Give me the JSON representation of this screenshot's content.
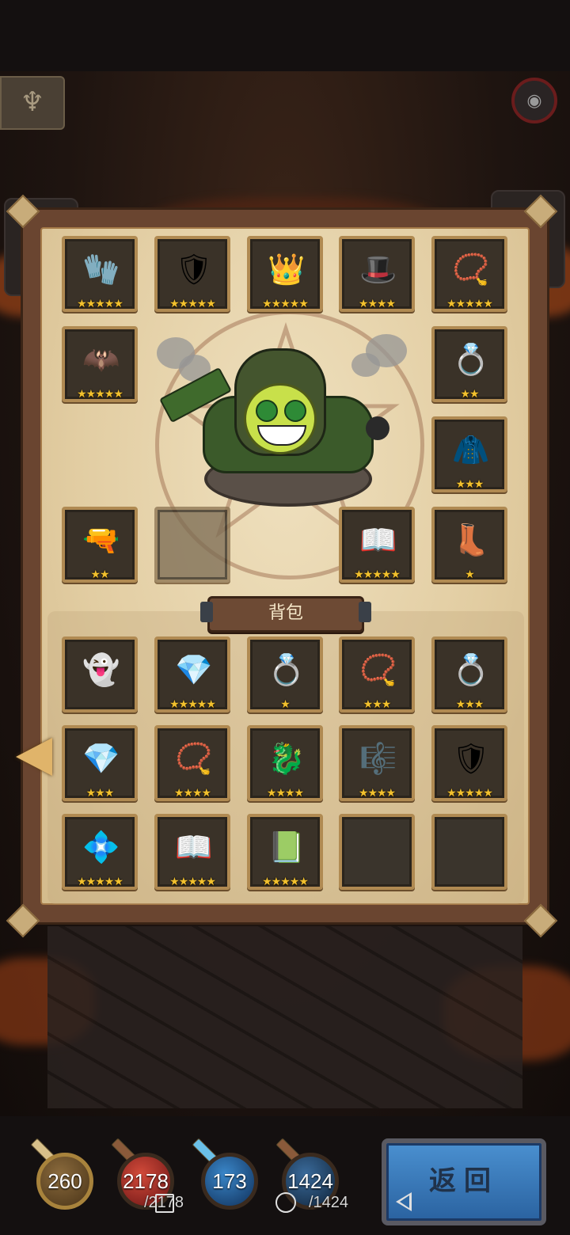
{
  "colors": {
    "star": "#f2c12e",
    "panel_bg": "#e2cda2",
    "slot_border": "#b08a52",
    "return_button": "#3a7cc0"
  },
  "equipment": [
    {
      "name": "glove",
      "icon": "purple-glove-icon",
      "glyph": "🧤",
      "stars": 5
    },
    {
      "name": "chest-armor",
      "icon": "purple-armor-icon",
      "glyph": "🛡",
      "stars": 5
    },
    {
      "name": "helmet",
      "icon": "flaming-crown-icon",
      "glyph": "👑",
      "stars": 5
    },
    {
      "name": "mask",
      "icon": "dark-hat-icon",
      "glyph": "🎩",
      "stars": 4
    },
    {
      "name": "amulet",
      "icon": "star-necklace-icon",
      "glyph": "📿",
      "stars": 5
    },
    {
      "name": "belt",
      "icon": "purple-belt-icon",
      "glyph": "🦇",
      "stars": 5
    },
    {
      "name": "ring",
      "icon": "silver-ring-icon",
      "glyph": "💍",
      "stars": 2
    },
    {
      "name": "cloak",
      "icon": "green-cloak-icon",
      "glyph": "🧥",
      "stars": 3
    },
    {
      "name": "weapon",
      "icon": "green-gun-icon",
      "glyph": "🔫",
      "stars": 2
    },
    {
      "name": "locked",
      "icon": "locked-slot-icon",
      "glyph": "",
      "stars": 0
    },
    {
      "name": "book",
      "icon": "fire-book-icon",
      "glyph": "📖",
      "stars": 5
    },
    {
      "name": "boots",
      "icon": "green-boots-icon",
      "glyph": "👢",
      "stars": 1
    }
  ],
  "bag": {
    "title": "背包",
    "items": [
      {
        "icon": "ghost-icon",
        "glyph": "👻",
        "stars": 0
      },
      {
        "icon": "purple-crystal-icon",
        "glyph": "💎",
        "stars": 5
      },
      {
        "icon": "silver-ring-icon",
        "glyph": "💍",
        "stars": 1
      },
      {
        "icon": "blue-necklace-icon",
        "glyph": "📿",
        "stars": 3
      },
      {
        "icon": "gold-ring-icon",
        "glyph": "💍",
        "stars": 3
      },
      {
        "icon": "ruby-ring-icon",
        "glyph": "💎",
        "stars": 3
      },
      {
        "icon": "pendant-necklace-icon",
        "glyph": "📿",
        "stars": 4
      },
      {
        "icon": "dragon-ring-icon",
        "glyph": "🐉",
        "stars": 4
      },
      {
        "icon": "harp-icon",
        "glyph": "🎼",
        "stars": 4
      },
      {
        "icon": "gold-armor-icon",
        "glyph": "🛡",
        "stars": 5
      },
      {
        "icon": "gold-belt-icon",
        "glyph": "💠",
        "stars": 5
      },
      {
        "icon": "gold-book-icon",
        "glyph": "📖",
        "stars": 5
      },
      {
        "icon": "wind-book-icon",
        "glyph": "📗",
        "stars": 5
      },
      {
        "icon": "empty",
        "glyph": "",
        "stars": 0
      },
      {
        "icon": "empty",
        "glyph": "",
        "stars": 0
      }
    ]
  },
  "stats": {
    "attack": "260",
    "hp": "2178",
    "hp_max": "/2178",
    "mana": "173",
    "shield": "1424",
    "shield_max": "/1424"
  },
  "return_button": "返回"
}
